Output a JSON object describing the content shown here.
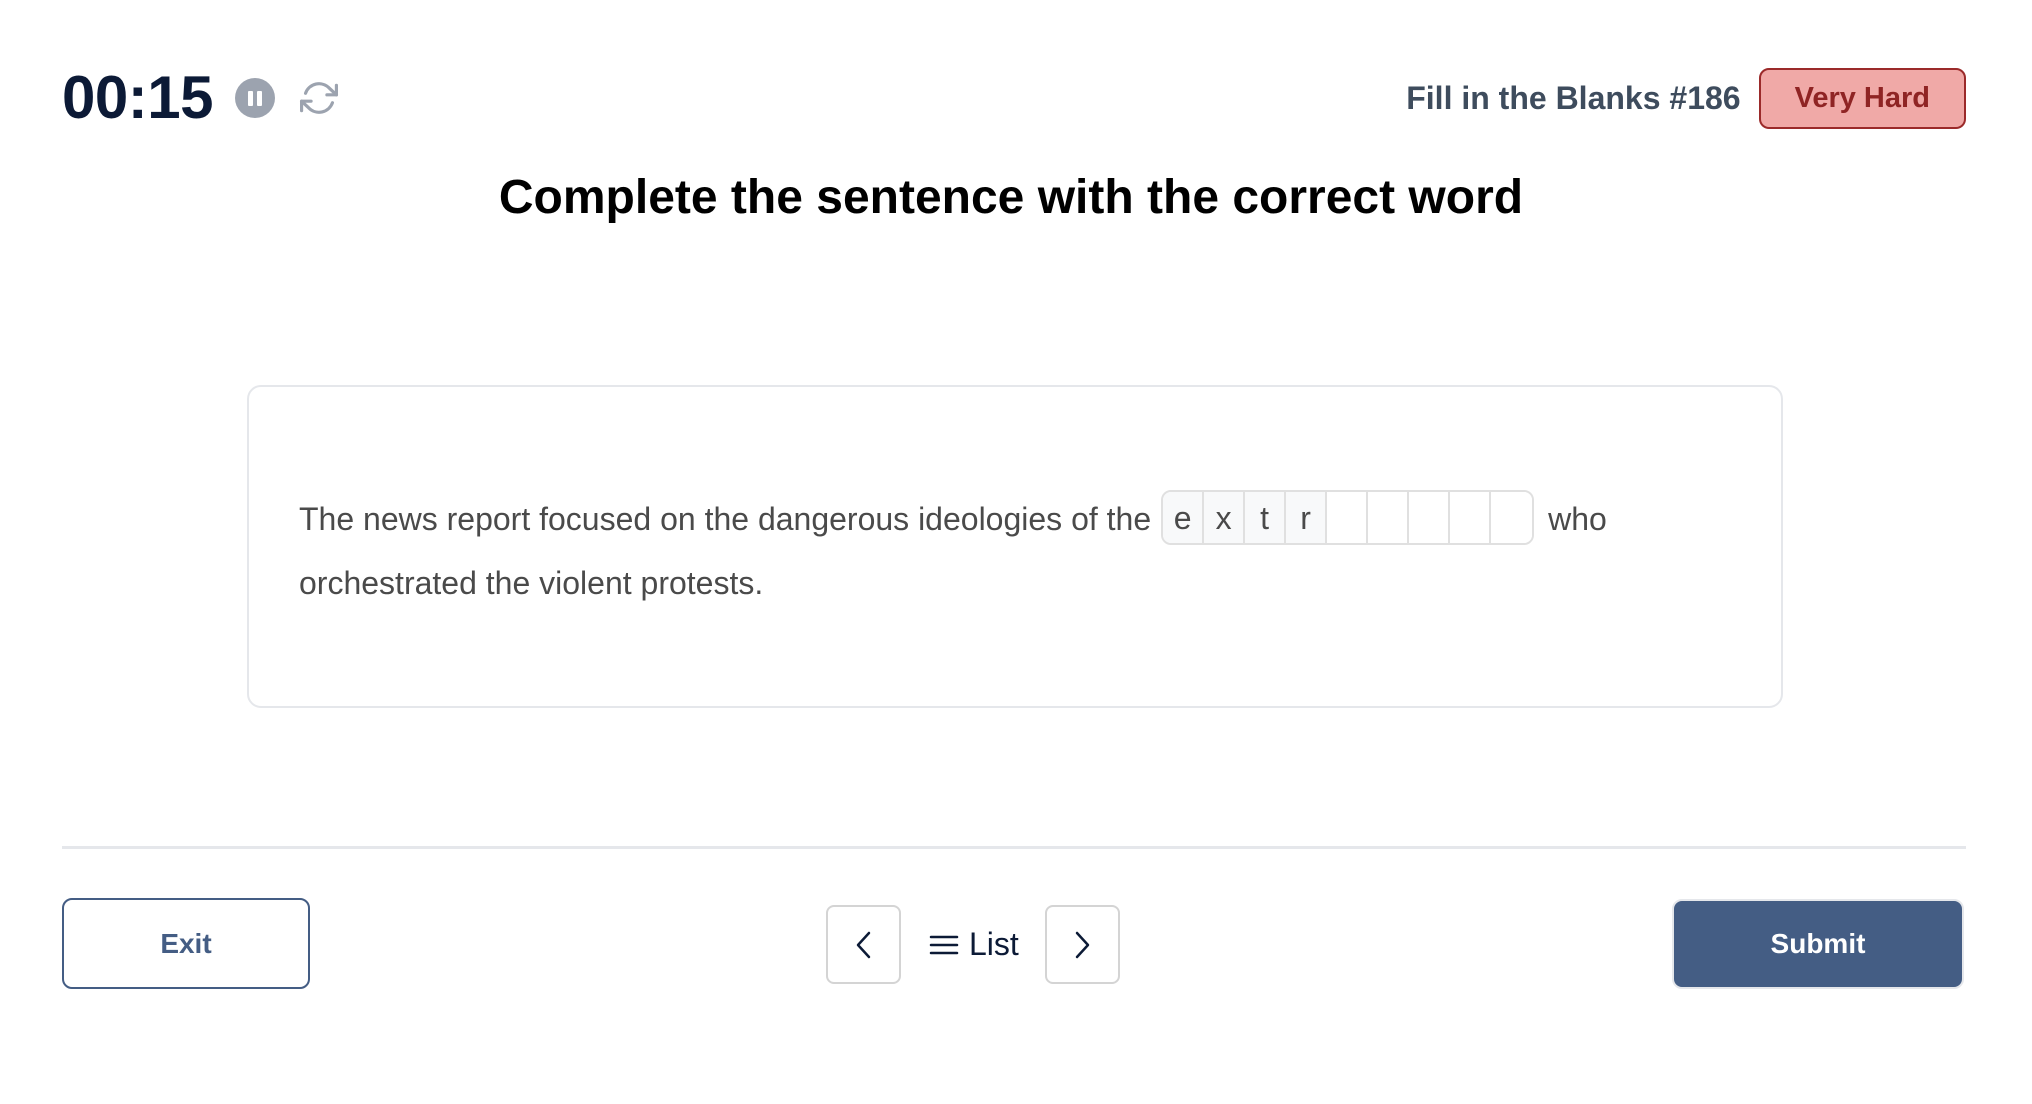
{
  "header": {
    "timer": "00:15",
    "puzzle_title": "Fill in the Blanks #186",
    "difficulty": "Very Hard"
  },
  "instruction": "Complete the sentence with the correct word",
  "question": {
    "before_blank": "The news report focused on the dangerous ideologies of the",
    "after_blank": "who orchestrated the violent protests.",
    "blank_cells": [
      "e",
      "x",
      "t",
      "r",
      "",
      "",
      "",
      "",
      ""
    ]
  },
  "footer": {
    "exit_label": "Exit",
    "list_label": "List",
    "submit_label": "Submit"
  },
  "colors": {
    "primary": "#445d84",
    "badge_bg": "#f0a9a7",
    "badge_text": "#8f2424",
    "timer_text": "#0c1a36"
  }
}
